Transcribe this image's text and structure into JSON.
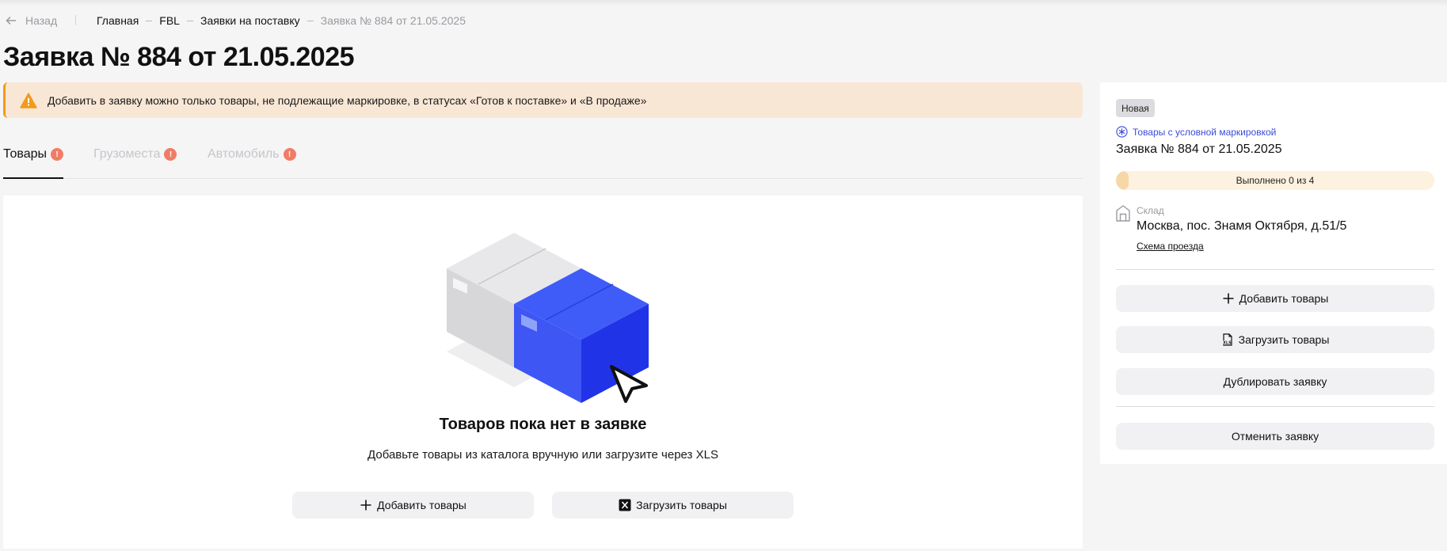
{
  "nav": {
    "back_label": "Назад",
    "breadcrumbs": [
      "Главная",
      "FBL",
      "Заявки на поставку",
      "Заявка № 884 от 21.05.2025"
    ]
  },
  "page_title": "Заявка № 884 от 21.05.2025",
  "warning": {
    "text": "Добавить в заявку можно только товары, не подлежащие маркировке, в статусах «Готов к поставке» и «В продаже»"
  },
  "tabs": [
    {
      "label": "Товары",
      "badge": "!",
      "active": true
    },
    {
      "label": "Грузоместа",
      "badge": "!",
      "active": false
    },
    {
      "label": "Автомобиль",
      "badge": "!",
      "active": false
    }
  ],
  "empty_state": {
    "title": "Товаров пока нет в заявке",
    "subtitle": "Добавьте товары из каталога вручную или загрузите через XLS",
    "add_button": "Добавить товары",
    "upload_button": "Загрузить товары"
  },
  "sidebar": {
    "status": "Новая",
    "marking_link": "Товары с условной маркировкой",
    "title": "Заявка № 884 от 21.05.2025",
    "progress": {
      "label": "Выполнено 0 из 4",
      "done": 0,
      "total": 4
    },
    "warehouse": {
      "label": "Склад",
      "address": "Москва, пос. Знамя Октября, д.51/5",
      "route_link": "Схема проезда"
    },
    "buttons": {
      "add": "Добавить товары",
      "upload": "Загрузить товары",
      "duplicate": "Дублировать заявку",
      "cancel": "Отменить заявку"
    }
  },
  "colors": {
    "accent_blue": "#2b3df2",
    "warning_bg": "#f9e7d6",
    "warning_border": "#f29a1a",
    "badge_red": "#f17c66",
    "link_blue": "#3b4bd8"
  },
  "icons": [
    "arrow-left-icon",
    "warning-triangle-icon",
    "box-illustration",
    "plus-icon",
    "xls-icon",
    "marking-icon",
    "warehouse-icon",
    "file-xls-icon"
  ]
}
